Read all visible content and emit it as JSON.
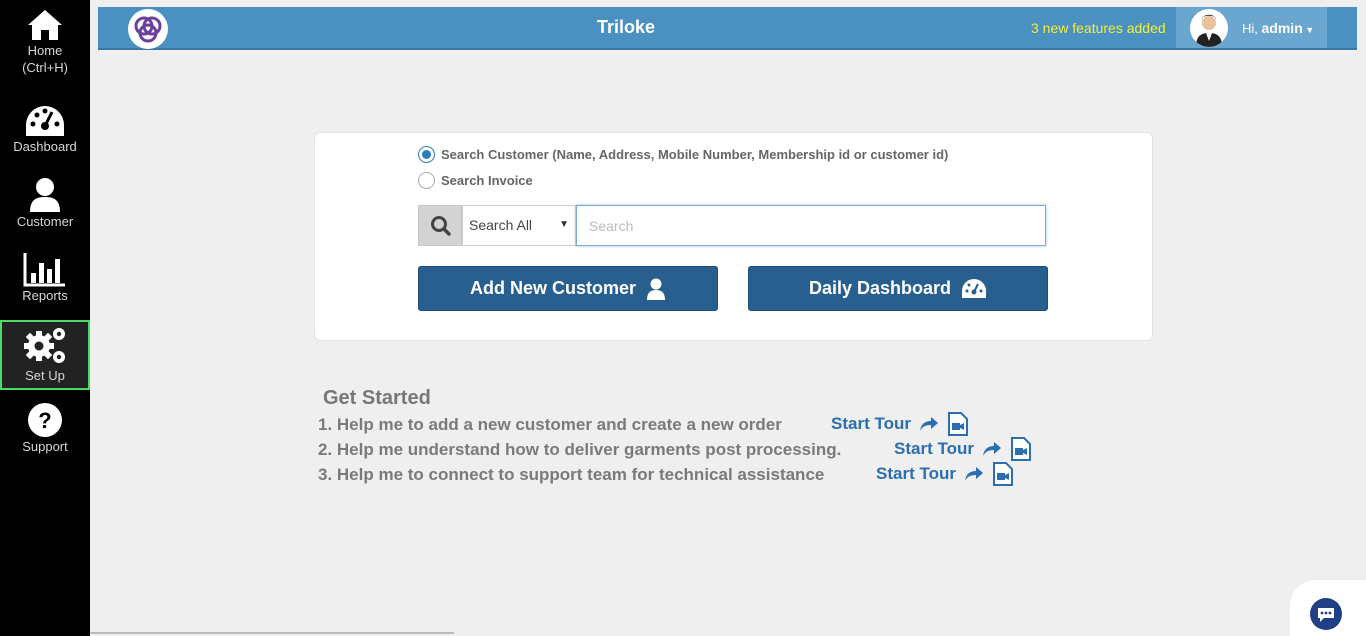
{
  "sidebar": {
    "items": [
      {
        "label": "Home",
        "sub": "(Ctrl+H)",
        "icon": "home-icon"
      },
      {
        "label": "Dashboard",
        "icon": "dashboard-icon"
      },
      {
        "label": "Customer",
        "icon": "user-icon"
      },
      {
        "label": "Reports",
        "icon": "bar-chart-icon"
      },
      {
        "label": "Set Up",
        "icon": "gears-icon",
        "active": true
      },
      {
        "label": "Support",
        "icon": "question-icon"
      }
    ]
  },
  "header": {
    "title": "Triloke",
    "features_notice": "3 new features added",
    "greeting": "Hi,",
    "username": "admin",
    "bg_color": "#4a90c0",
    "notice_color": "#f6ee3a"
  },
  "search": {
    "option_customer": "Search Customer (Name, Address, Mobile Number, Membership id or customer id)",
    "option_invoice": "Search Invoice",
    "selected_option": "customer",
    "scope_value": "Search All",
    "placeholder": "Search"
  },
  "actions": {
    "add_customer": "Add New Customer",
    "daily_dashboard": "Daily Dashboard",
    "button_color": "#285f8f"
  },
  "get_started": {
    "title": "Get Started",
    "items": [
      {
        "text": "1. Help me to add a new customer and create a new order",
        "tour": "Start Tour"
      },
      {
        "text": "2. Help me understand how to deliver garments post processing.",
        "tour": "Start Tour"
      },
      {
        "text": "3. Help me to connect to support team for technical assistance",
        "tour": "Start Tour"
      }
    ]
  }
}
